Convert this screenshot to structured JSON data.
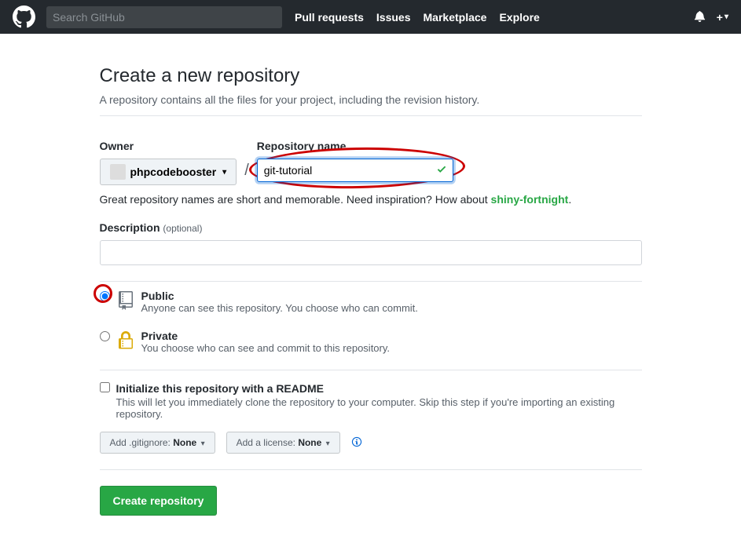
{
  "header": {
    "search_placeholder": "Search GitHub",
    "nav": {
      "pull_requests": "Pull requests",
      "issues": "Issues",
      "marketplace": "Marketplace",
      "explore": "Explore"
    },
    "plus": "+"
  },
  "page": {
    "title": "Create a new repository",
    "subtitle": "A repository contains all the files for your project, including the revision history."
  },
  "form": {
    "owner_label": "Owner",
    "owner_value": "phpcodebooster",
    "slash": "/",
    "repo_name_label": "Repository name",
    "repo_name_value": "git-tutorial",
    "hint_prefix": "Great repository names are short and memorable. Need inspiration? How about ",
    "hint_suggestion": "shiny-fortnight",
    "hint_suffix": ".",
    "description_label": "Description ",
    "description_optional": "(optional)",
    "description_value": "",
    "visibility": {
      "public_title": "Public",
      "public_desc": "Anyone can see this repository. You choose who can commit.",
      "private_title": "Private",
      "private_desc": "You choose who can see and commit to this repository."
    },
    "readme": {
      "title": "Initialize this repository with a README",
      "desc": "This will let you immediately clone the repository to your computer. Skip this step if you're importing an existing repository."
    },
    "gitignore_prefix": "Add .gitignore: ",
    "gitignore_value": "None",
    "license_prefix": "Add a license: ",
    "license_value": "None",
    "submit": "Create repository"
  }
}
